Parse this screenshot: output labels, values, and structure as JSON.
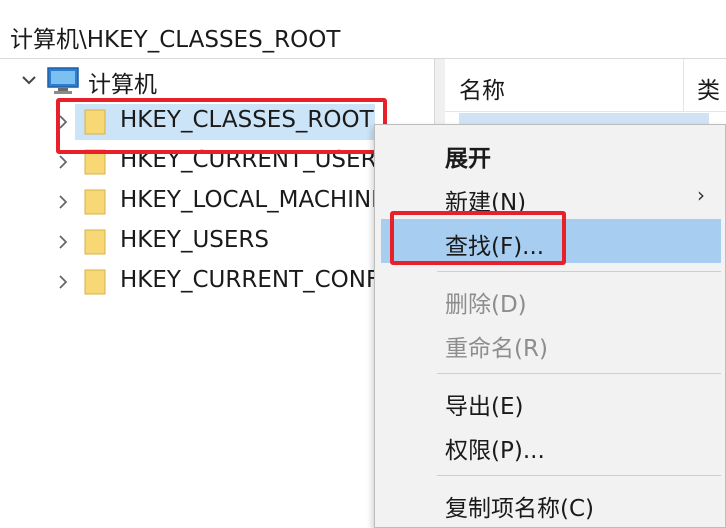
{
  "address": {
    "path": "计算机\\HKEY_CLASSES_ROOT"
  },
  "tree": {
    "root_label": "计算机",
    "items": [
      {
        "label": "HKEY_CLASSES_ROOT",
        "selected": true
      },
      {
        "label": "HKEY_CURRENT_USER"
      },
      {
        "label": "HKEY_LOCAL_MACHINE"
      },
      {
        "label": "HKEY_USERS"
      },
      {
        "label": "HKEY_CURRENT_CONFIG"
      }
    ]
  },
  "list": {
    "column_name": "名称",
    "column_next": "类"
  },
  "context_menu": {
    "items": [
      {
        "label": "展开",
        "bold": true
      },
      {
        "label": "新建(N)",
        "submenu": true
      },
      {
        "label": "查找(F)...",
        "hover": true
      },
      {
        "label": "删除(D)",
        "disabled": true
      },
      {
        "label": "重命名(R)",
        "disabled": true
      },
      {
        "label": "导出(E)"
      },
      {
        "label": "权限(P)..."
      },
      {
        "label": "复制项名称(C)"
      }
    ],
    "submenu_glyph": "›"
  },
  "icons": {
    "expand": "chevron-down-icon",
    "collapsed": "chevron-right-icon",
    "computer": "computer-icon",
    "folder": "folder-icon"
  },
  "colors": {
    "highlight_box": "#e8202a",
    "selection": "#cce4f7",
    "menu_hover": "#a7cdf0",
    "folder_fill": "#f8d775"
  }
}
